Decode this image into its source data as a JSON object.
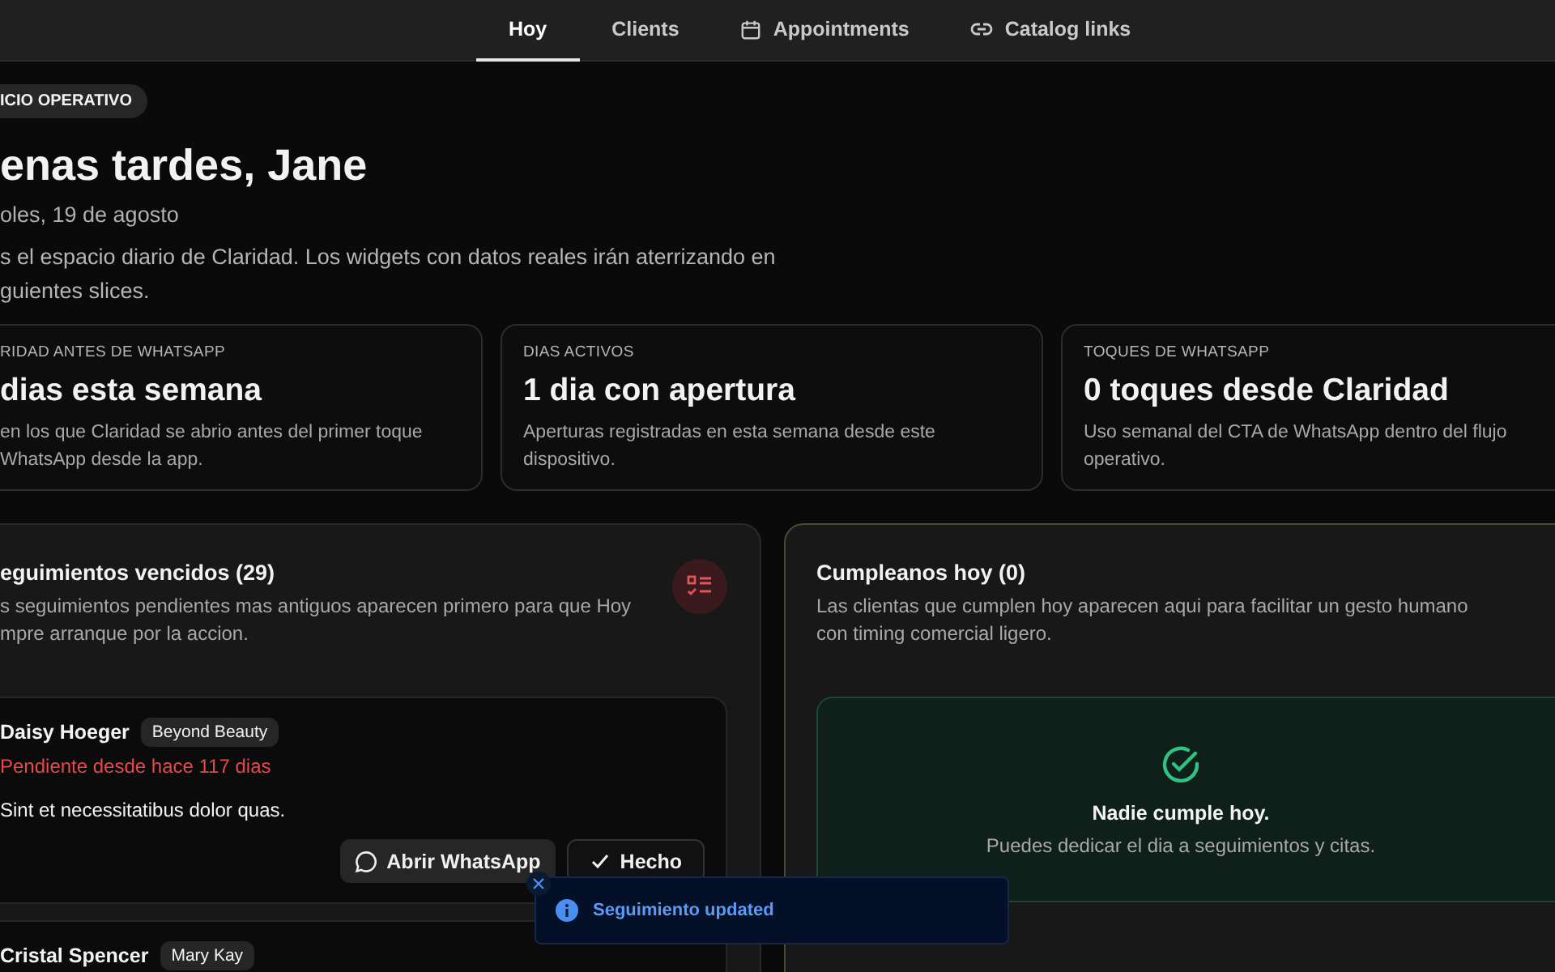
{
  "nav": {
    "tabs": [
      {
        "label": "Hoy",
        "selected": true,
        "kind": "plain"
      },
      {
        "label": "Clients",
        "selected": false,
        "kind": "plain"
      },
      {
        "label": "Appointments",
        "selected": false,
        "kind": "calendar"
      },
      {
        "label": "Catalog links",
        "selected": false,
        "kind": "link"
      }
    ]
  },
  "hero": {
    "badge": "ICIO OPERATIVO",
    "greeting": "enas tardes, Jane",
    "date": "oles, 19 de agosto",
    "description": "s el espacio diario de Claridad. Los widgets con datos reales irán aterrizando en guientes slices."
  },
  "stats": [
    {
      "label": "RIDAD ANTES DE WHATSAPP",
      "value": "dias esta semana",
      "description": "en los que Claridad se abrio antes del primer toque WhatsApp desde la app."
    },
    {
      "label": "DIAS ACTIVOS",
      "value": "1 dia con apertura",
      "description": "Aperturas registradas en esta semana desde este dispositivo."
    },
    {
      "label": "TOQUES DE WHATSAPP",
      "value": "0 toques desde Claridad",
      "description": "Uso semanal del CTA de WhatsApp dentro del flujo operativo."
    }
  ],
  "followups": {
    "title": "eguimientos vencidos (29)",
    "description": "s seguimientos pendientes mas antiguos aparecen primero para que Hoy mpre arranque por la accion.",
    "items": [
      {
        "name": "Daisy Hoeger",
        "brand": "Beyond Beauty",
        "status": "Pendiente desde hace 117 dias",
        "note": "Sint et necessitatibus dolor quas.",
        "actions": [
          {
            "label": "Abrir WhatsApp",
            "kind": "whatsapp"
          },
          {
            "label": "Hecho",
            "kind": "done"
          }
        ]
      },
      {
        "name": "Cristal Spencer",
        "brand": "Mary Kay"
      }
    ]
  },
  "birthdays": {
    "title": "Cumpleanos hoy (0)",
    "description": "Las clientas que cumplen hoy aparecen aqui para facilitar un gesto humano con timing comercial ligero.",
    "empty": {
      "title": "Nadie cumple hoy.",
      "text": "Puedes dedicar el dia a seguimientos y citas."
    }
  },
  "toast": {
    "message": "Seguimiento updated"
  }
}
